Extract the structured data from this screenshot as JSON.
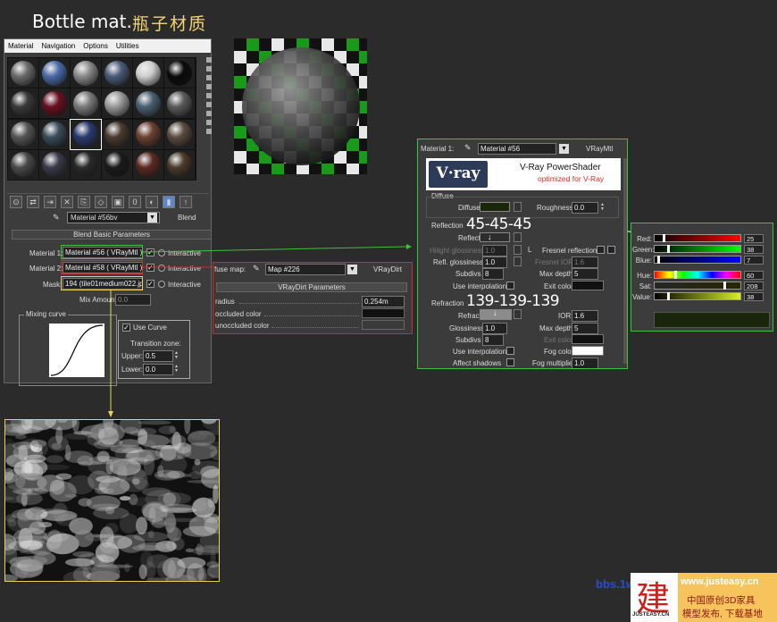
{
  "header": {
    "title": "Bottle mat.",
    "title_cn": "瓶子材质"
  },
  "material_editor": {
    "menu": [
      "Material",
      "Navigation",
      "Options",
      "Utilities"
    ],
    "material_name": "Material #56bv",
    "material_type": "Blend",
    "rollout_title": "Blend Basic Parameters",
    "material1_label": "Material 1:",
    "material1_value": "Material #56  ( VRayMtl )",
    "material2_label": "Material 2:",
    "material2_value": "Material #58  ( VRayMtl )",
    "mask_label": "Mask:",
    "mask_value": "194 (tile01medium022.jpg)",
    "interactive_label": "Interactive",
    "mix_amount_label": "Mix Amount:",
    "mix_amount_value": "0.0",
    "mixing_curve_label": "Mixing curve",
    "use_curve_label": "Use Curve",
    "transition_zone_label": "Transition zone:",
    "upper_label": "Upper:",
    "upper_value": "0.5",
    "lower_label": "Lower:",
    "lower_value": "0.0"
  },
  "dirt": {
    "map_label": "fuse map:",
    "map_name": "Map #226",
    "map_type": "VRayDirt",
    "rollout_title": "VRayDirt Parameters",
    "radius_label": "radius",
    "radius_value": "0.254m",
    "occluded_label": "occluded color",
    "unoccluded_label": "unoccluded color"
  },
  "vray": {
    "material_label": "Material 1:",
    "material_name": "Material #56",
    "material_type": "VRayMtl",
    "logo_text": "V·ray",
    "banner_title": "V-Ray PowerShader",
    "banner_subtitle": "optimized for V-Ray",
    "diffuse_group": "Diffuse",
    "diffuse_label": "Diffuse",
    "roughness_label": "Roughness",
    "roughness_value": "0.0",
    "reflection_group": "Reflection",
    "reflect_label": "Reflect",
    "hilight_label": "Hilight glossiness",
    "hilight_value": "1.0",
    "l_label": "L",
    "fresnel_label": "Fresnel reflections",
    "refl_gloss_label": "Refl. glossiness",
    "refl_gloss_value": "1.0",
    "fresnel_ior_label": "Fresnel IOR",
    "fresnel_ior_value": "1.6",
    "subdivs_label": "Subdivs",
    "subdivs_value": "8",
    "max_depth_label": "Max depth",
    "max_depth_value": "5",
    "use_interp_label": "Use interpolation",
    "exit_color_label": "Exit color",
    "refraction_group": "Refraction",
    "refract_label": "Refract",
    "ior_label": "IOR",
    "ior_value": "1.6",
    "glossiness_label": "Glossiness",
    "glossiness_value": "1.0",
    "max_depth2_value": "5",
    "subdivs2_value": "8",
    "exit_color2_label": "Exit color",
    "fog_color_label": "Fog color",
    "affect_shadows_label": "Affect shadows",
    "fog_mult_label": "Fog multiplier",
    "fog_mult_value": "1.0",
    "annotation_reflect": "45-45-45",
    "annotation_refract": "139-139-139"
  },
  "picker": {
    "red_label": "Red:",
    "red_value": "25",
    "green_label": "Green:",
    "green_value": "38",
    "blue_label": "Blue:",
    "blue_value": "7",
    "hue_label": "Hue:",
    "hue_value": "60",
    "sat_label": "Sat:",
    "sat_value": "208",
    "value_label": "Value:",
    "value_value": "38",
    "red_level": 0.098,
    "green_level": 0.149,
    "blue_level": 0.027,
    "hue_level": 0.235,
    "sat_level": 0.816,
    "value_level": 0.149,
    "swatch_color": "#19260a"
  },
  "logo": {
    "url": "bbs.1wk.com",
    "site": "www.justeasy.cn",
    "line1": "中国原创3D家具",
    "line2": "模型发布, 下载基地",
    "char": "建",
    "brand": "JUSTEASY.CN"
  },
  "colors": {
    "highlight_green": "#3cc23c",
    "highlight_red": "#c83030",
    "highlight_yellow": "#e8d060",
    "diffuse_swatch": "#19260a",
    "reflect_swatch": "#2d2d2d",
    "refract_swatch": "#8b8b8b",
    "fog_swatch": "#ffffff"
  }
}
